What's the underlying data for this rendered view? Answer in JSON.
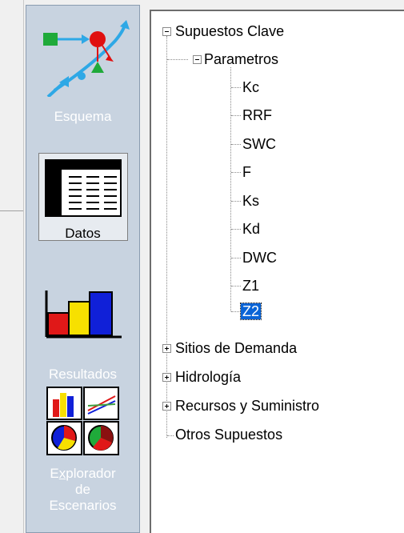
{
  "viewbar": {
    "items": [
      {
        "label": "Esquema",
        "icon": "schematic-icon",
        "active": false
      },
      {
        "label": "Datos",
        "icon": "data-table-icon",
        "active": true
      },
      {
        "label": "Resultados",
        "icon": "results-chart-icon",
        "active": false
      },
      {
        "label_pre": "E",
        "label_u": "x",
        "label_post": "plorador",
        "label_line2": "de",
        "label_line3": "Escenarios",
        "icon": "scenario-explorer-icon",
        "active": false
      }
    ]
  },
  "tree": {
    "root": "Supuestos Clave",
    "group": "Parametros",
    "params": [
      "Kc",
      "RRF",
      "SWC",
      "F",
      "Ks",
      "Kd",
      "DWC",
      "Z1",
      "Z2"
    ],
    "selected": "Z2",
    "siblings": [
      "Sitios de Demanda",
      "Hidrología",
      "Recursos y Suministro",
      "Otros Supuestos"
    ]
  },
  "colors": {
    "viewbar_bg": "#c8d3e0",
    "selection": "#0a64d6"
  }
}
